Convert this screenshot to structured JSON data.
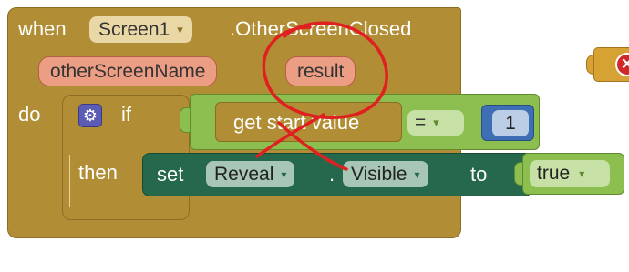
{
  "event_block": {
    "when_label": "when",
    "component": "Screen1",
    "event_name": ".OtherScreenClosed",
    "params": [
      "otherScreenName",
      "result"
    ],
    "do_label": "do"
  },
  "if_block": {
    "if_label": "if",
    "then_label": "then",
    "gear_icon": "gear-icon"
  },
  "condition": {
    "get_label": "get start value",
    "operator": "=",
    "value": "1"
  },
  "set_block": {
    "set_label": "set",
    "component": "Reveal",
    "dot": ".",
    "property": "Visible",
    "to_label": "to",
    "value": "true"
  },
  "annotations": {
    "circle_color": "#e02020",
    "cross_color": "#e02020"
  },
  "colors": {
    "event_block": "#b18e35",
    "param": "#ec9e84",
    "logic_green": "#8cbf4f",
    "set_green": "#26684b",
    "math_blue": "#3e6fb5",
    "error_red": "#d02828"
  },
  "caret": "▾"
}
